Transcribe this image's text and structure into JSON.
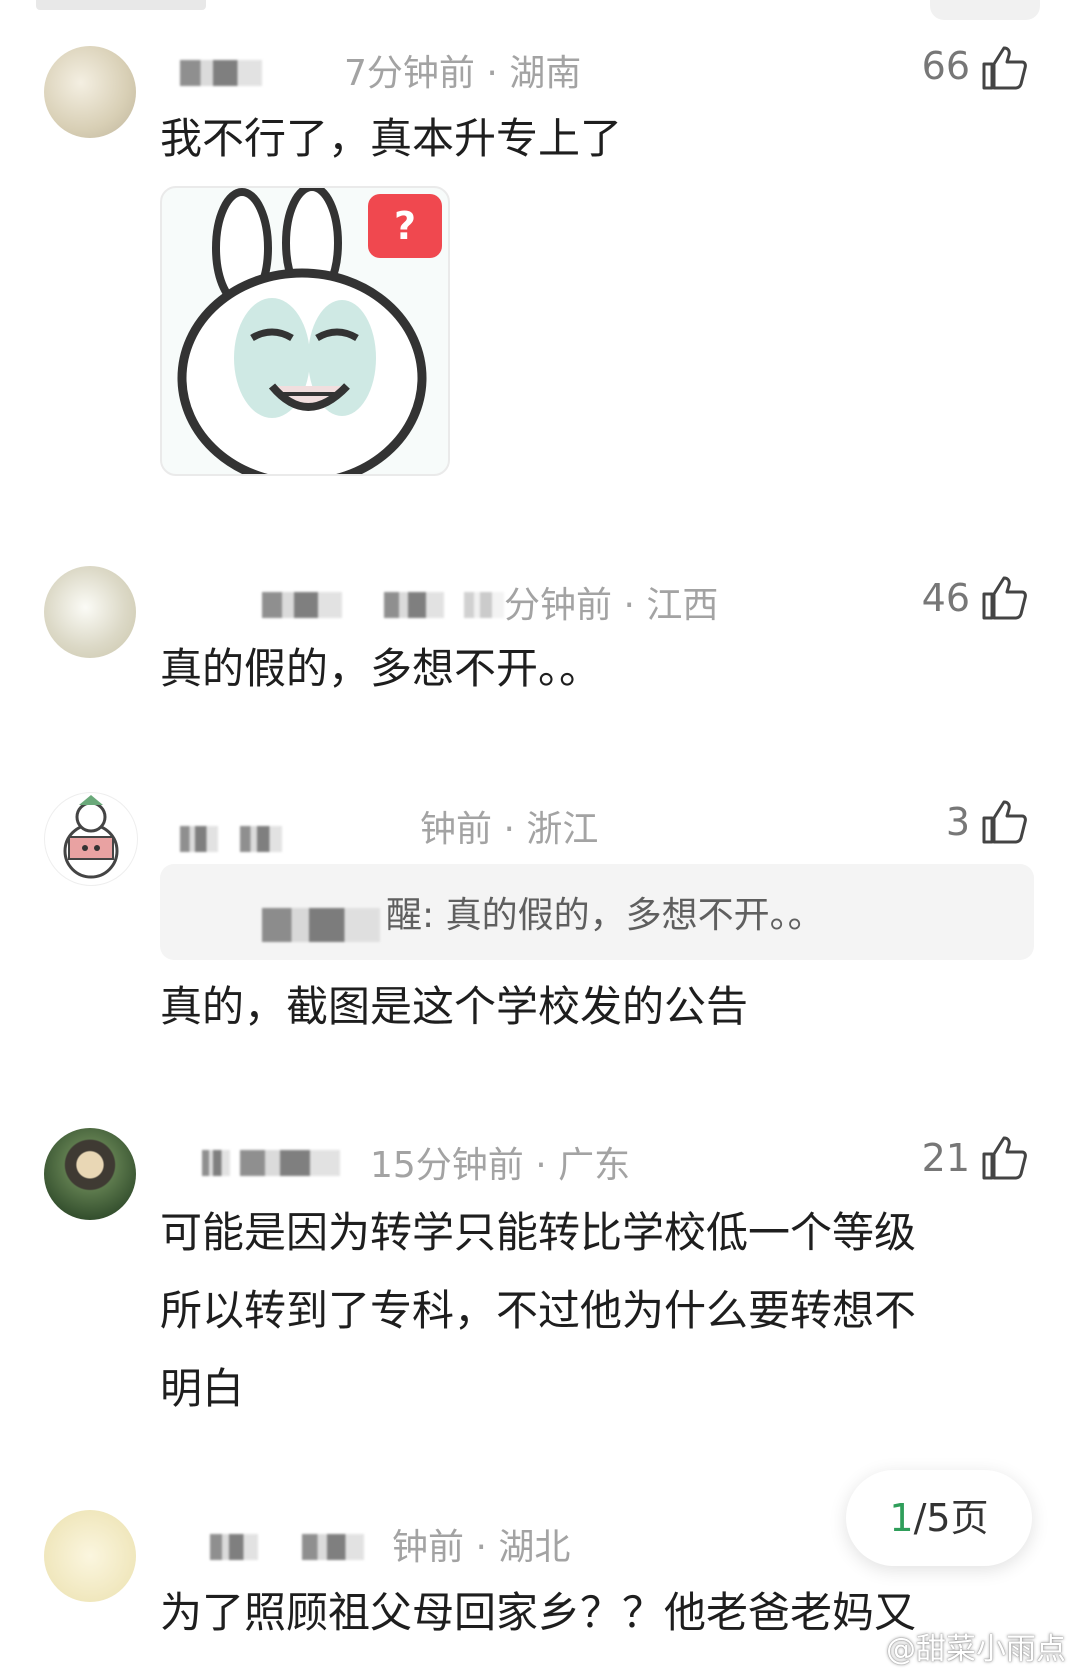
{
  "comments": [
    {
      "time_location": "7分钟前 · 湖南",
      "likes": "66",
      "text": "我不行了，真本升专上了"
    },
    {
      "time_location": "分钟前 · 江西",
      "likes": "46",
      "text": "真的假的，多想不开。。"
    },
    {
      "time_location": "钟前 · 浙江",
      "likes": "3",
      "reply_to": "醒: 真的假的，多想不开。。",
      "text": "真的，截图是这个学校发的公告"
    },
    {
      "time_location": "15分钟前 · 广东",
      "likes": "21",
      "text_lines": [
        "可能是因为转学只能转比学校低一个等级",
        "所以转到了专科，不过他为什么要转想不",
        "明白"
      ]
    },
    {
      "time_location": "钟前 · 湖北",
      "text": "为了照顾祖父母回家乡？？他老爸老妈又"
    }
  ],
  "sticker": {
    "badge": "?"
  },
  "pager": {
    "current": "1",
    "rest": "/5页"
  },
  "watermark": "@甜菜小雨点",
  "colors": {
    "accent": "#2f9e5a",
    "badge": "#f0484f",
    "meta": "#a3a3a3"
  }
}
